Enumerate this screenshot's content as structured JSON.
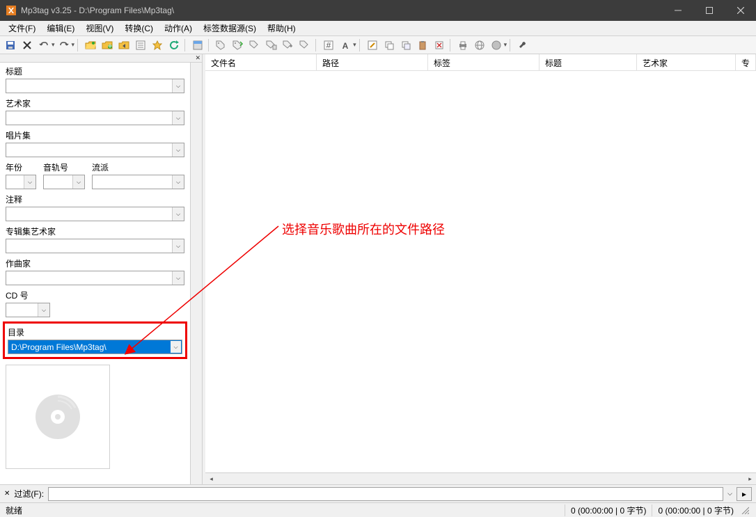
{
  "window": {
    "title": "Mp3tag v3.25  -  D:\\Program Files\\Mp3tag\\"
  },
  "menus": [
    "文件(F)",
    "编辑(E)",
    "视图(V)",
    "转换(C)",
    "动作(A)",
    "标签数据源(S)",
    "帮助(H)"
  ],
  "sidebar": {
    "fields": {
      "title": "标题",
      "artist": "艺术家",
      "album": "唱片集",
      "year": "年份",
      "track": "音轨号",
      "genre": "流派",
      "comment": "注释",
      "albumartist": "专辑集艺术家",
      "composer": "作曲家",
      "discnum": "CD 号",
      "directory": "目录",
      "directory_value": "D:\\Program Files\\Mp3tag\\"
    }
  },
  "columns": [
    {
      "label": "文件名",
      "width": 160
    },
    {
      "label": "路径",
      "width": 160
    },
    {
      "label": "标签",
      "width": 160
    },
    {
      "label": "标题",
      "width": 140
    },
    {
      "label": "艺术家",
      "width": 142
    },
    {
      "label": "专",
      "width": 20
    }
  ],
  "filter": {
    "label": "过滤(F):"
  },
  "status": {
    "ready": "就绪",
    "cell1": "0 (00:00:00 | 0 字节)",
    "cell2": "0 (00:00:00 | 0 字节)"
  },
  "annotation": "选择音乐歌曲所在的文件路径"
}
